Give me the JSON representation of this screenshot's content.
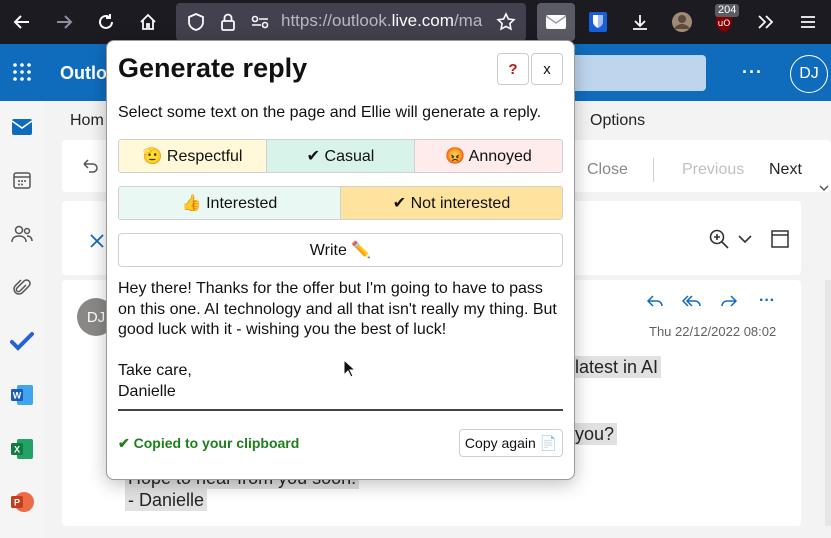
{
  "browser": {
    "url_prefix": "https://outlook.",
    "url_domain": "live.com",
    "url_suffix": "/ma",
    "ext_badge": "204"
  },
  "outlook": {
    "app_name_partial": "Outlo",
    "avatar_initials": "DJ",
    "more_label": "···",
    "tabs": {
      "home_partial": "Hom",
      "options": "Options"
    },
    "ribbon": {
      "close": "Close",
      "previous": "Previous",
      "next": "Next"
    },
    "email": {
      "sender_initials": "DJ",
      "date": "Thu 22/12/2022 08:02",
      "fragment_1": "latest in AI",
      "fragment_2": "you?",
      "fragment_3": "Hope to hear from you soon!",
      "fragment_4": "- Danielle"
    }
  },
  "popup": {
    "title": "Generate reply",
    "help_label": "?",
    "close_label": "x",
    "instructions": "Select some text on the page and Ellie will generate a reply.",
    "tones_row1": [
      {
        "label": "🫡 Respectful",
        "bg": "#fff9d9"
      },
      {
        "label": "✔ Casual",
        "bg": "#d8f3ea"
      },
      {
        "label": "😡 Annoyed",
        "bg": "#fdeceb"
      }
    ],
    "tones_row2": [
      {
        "label": "👍 Interested",
        "bg": "#e9f8f3"
      },
      {
        "label": "✔ Not interested",
        "bg": "#fde39d"
      }
    ],
    "write_label": "Write ✏️",
    "reply_text": "Hey there! Thanks for the offer but I'm going to have to pass on this one. AI technology and all that isn't really my thing. But good luck with it - wishing you the best of luck!\n\nTake care,\nDanielle",
    "copied_status": "✔ Copied to your clipboard",
    "copy_again_label": "Copy again 📄"
  },
  "colors": {
    "outlook_blue": "#0f6cbd",
    "browser_chrome": "#1c1b22",
    "success_green": "#1e7d1e"
  }
}
